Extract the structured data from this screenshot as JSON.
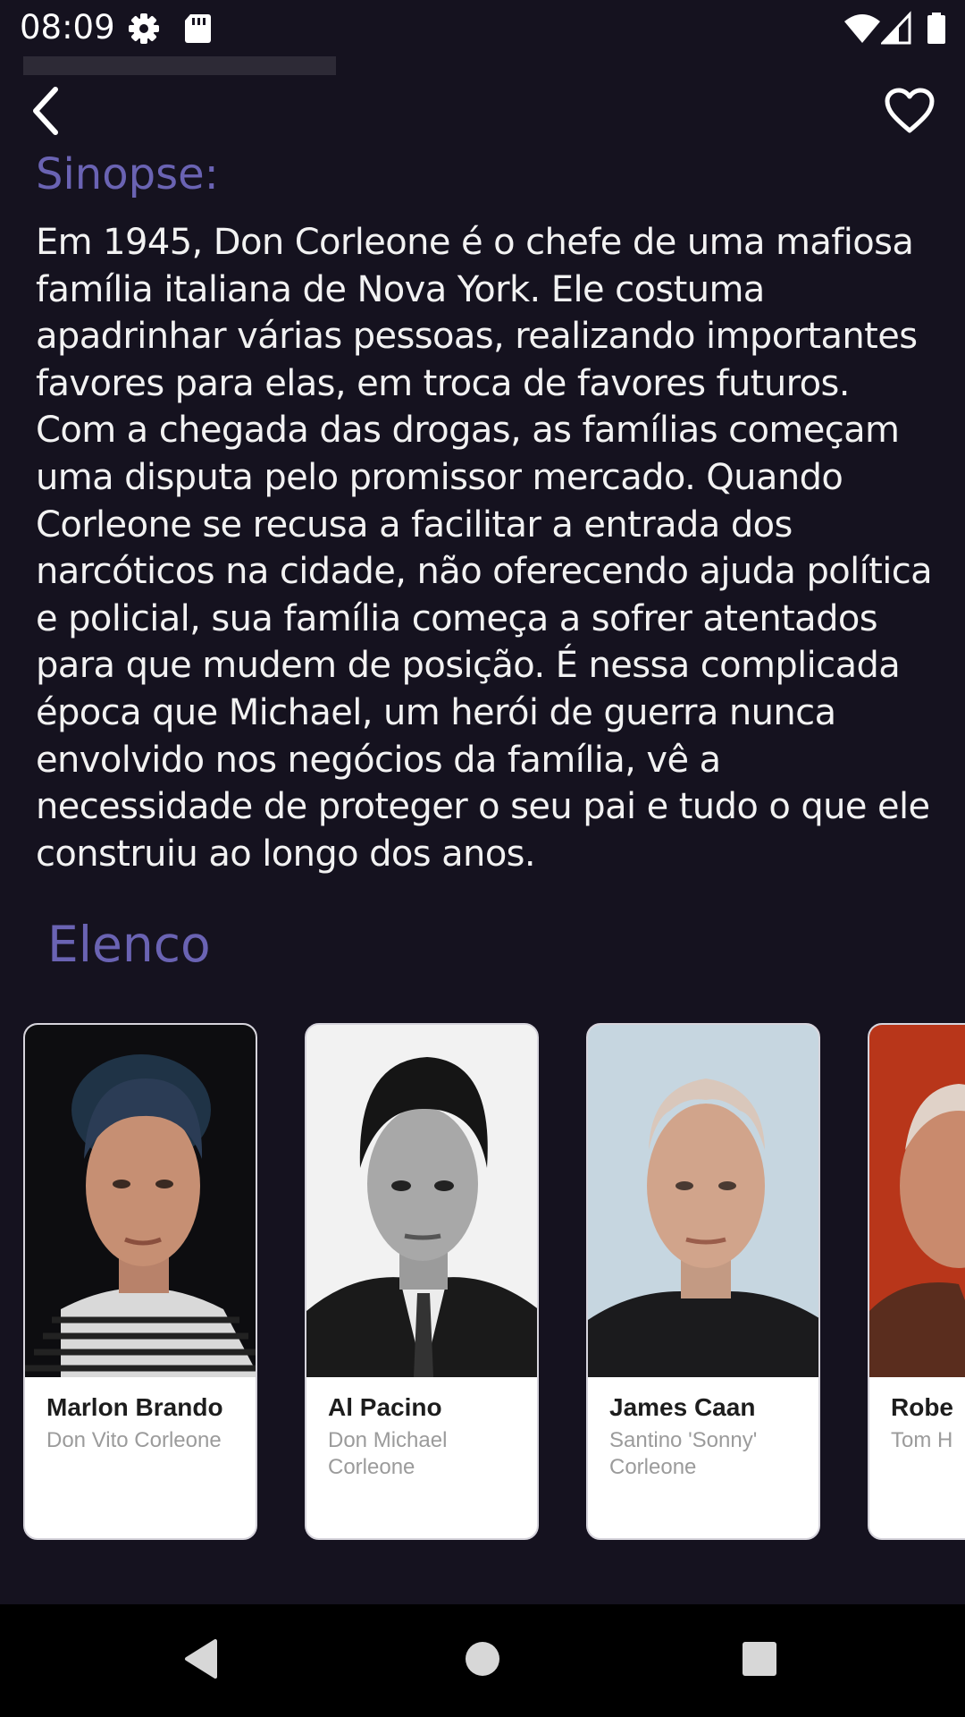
{
  "status_bar": {
    "time": "08:09",
    "icons": [
      "gear-icon",
      "sd-card-icon",
      "wifi-icon",
      "signal-icon",
      "battery-icon"
    ]
  },
  "toolbar": {
    "back_icon": "chevron-left-icon",
    "favorite_icon": "heart-outline-icon"
  },
  "synopsis": {
    "title": "Sinopse:",
    "text": "Em 1945, Don Corleone é o chefe de uma mafiosa família italiana de Nova York. Ele costuma apadrinhar várias pessoas, realizando importantes favores para elas, em troca de favores futuros. Com a chegada das drogas, as famílias começam uma disputa pelo promissor mercado. Quando Corleone se recusa a facilitar a entrada dos narcóticos na cidade, não oferecendo ajuda política e policial, sua família começa a sofrer atentados para que mudem de posição. É nessa complicada época que Michael, um herói de guerra nunca envolvido nos negócios da família, vê a necessidade de proteger o seu pai e tudo o que ele construiu ao longo dos anos."
  },
  "cast": {
    "title": "Elenco",
    "members": [
      {
        "name": "Marlon Brando",
        "role": "Don Vito Corleone"
      },
      {
        "name": "Al Pacino",
        "role": "Don Michael Corleone"
      },
      {
        "name": "James Caan",
        "role": "Santino 'Sonny' Corleone"
      },
      {
        "name": "Robe",
        "role": "Tom H"
      }
    ]
  },
  "navigation": {
    "icons": [
      "back-triangle-icon",
      "home-circle-icon",
      "recents-square-icon"
    ]
  },
  "colors": {
    "background": "#15121f",
    "accent": "#6a63b3",
    "card": "#ffffff"
  }
}
